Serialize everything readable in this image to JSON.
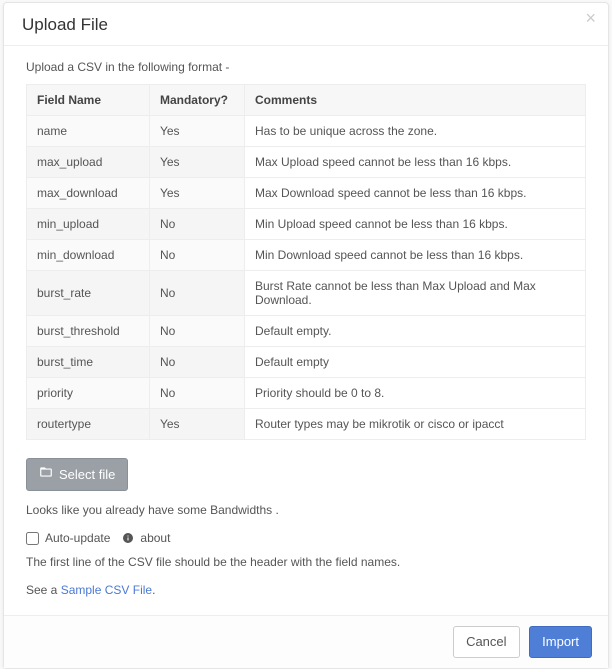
{
  "header": {
    "title": "Upload File"
  },
  "intro": "Upload a CSV in the following format -",
  "table": {
    "headers": {
      "field": "Field Name",
      "mandatory": "Mandatory?",
      "comments": "Comments"
    },
    "rows": [
      {
        "field": "name",
        "mandatory": "Yes",
        "comments": "Has to be unique across the zone."
      },
      {
        "field": "max_upload",
        "mandatory": "Yes",
        "comments": "Max Upload speed cannot be less than 16 kbps."
      },
      {
        "field": "max_download",
        "mandatory": "Yes",
        "comments": "Max Download speed cannot be less than 16 kbps."
      },
      {
        "field": "min_upload",
        "mandatory": "No",
        "comments": "Min Upload speed cannot be less than 16 kbps."
      },
      {
        "field": "min_download",
        "mandatory": "No",
        "comments": "Min Download speed cannot be less than 16 kbps."
      },
      {
        "field": "burst_rate",
        "mandatory": "No",
        "comments": "Burst Rate cannot be less than Max Upload and Max Download."
      },
      {
        "field": "burst_threshold",
        "mandatory": "No",
        "comments": "Default empty."
      },
      {
        "field": "burst_time",
        "mandatory": "No",
        "comments": "Default empty"
      },
      {
        "field": "priority",
        "mandatory": "No",
        "comments": "Priority should be 0 to 8."
      },
      {
        "field": "routertype",
        "mandatory": "Yes",
        "comments": "Router types may be mikrotik or cisco or ipacct"
      }
    ]
  },
  "select_file_label": "Select file",
  "existing_note": "Looks like you already have some Bandwidths .",
  "auto_update_label": "Auto-update",
  "about_label": "about",
  "header_line_note": "The first line of the CSV file should be the header with the field names.",
  "sample_prefix": "See a ",
  "sample_link": "Sample CSV File",
  "sample_suffix": ".",
  "footer": {
    "cancel": "Cancel",
    "import": "Import"
  }
}
